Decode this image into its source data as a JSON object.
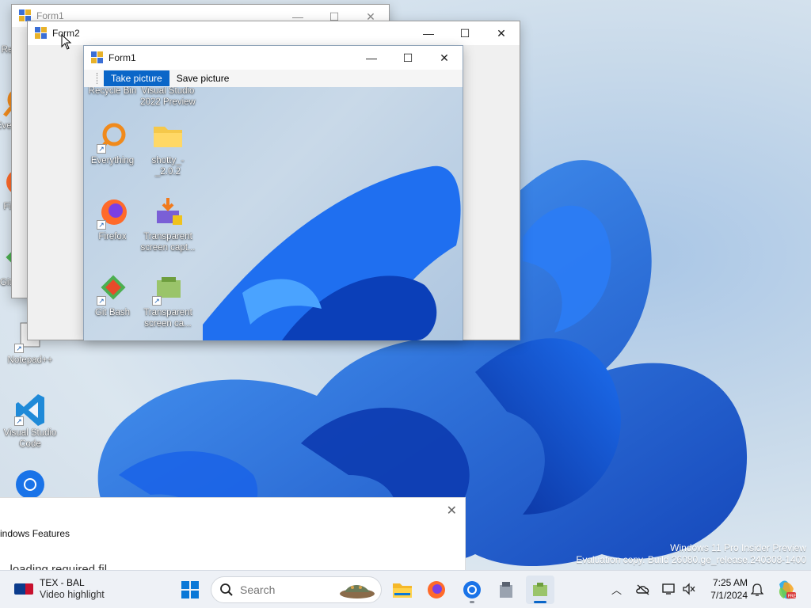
{
  "desktop": {
    "icons_outer": [
      {
        "label": "Recycle Bin"
      },
      {
        "label": "Everything"
      },
      {
        "label": "Firefox"
      },
      {
        "label": "Git Bash"
      },
      {
        "label": "Notepad++"
      },
      {
        "label": "Visual Studio Code"
      }
    ]
  },
  "form1_back": {
    "title": "Form1"
  },
  "form2": {
    "title": "Form2"
  },
  "form1": {
    "title": "Form1",
    "menu": {
      "take_label": "Take picture",
      "save_label": "Save picture"
    },
    "icons": [
      {
        "label": "Recycle Bin"
      },
      {
        "label": "Visual Studio 2022 Preview"
      },
      {
        "label": "Everything"
      },
      {
        "label": "shotty_-_2.0.2"
      },
      {
        "label": "Firefox"
      },
      {
        "label": "Transparent screen capt..."
      },
      {
        "label": "Git Bash"
      },
      {
        "label": "Transparent screen ca..."
      }
    ]
  },
  "notification": {
    "feature_text": "indows Features",
    "sub_text": "...loading required fil..."
  },
  "watermark": {
    "line1": "Windows 11 Pro Insider Preview",
    "line2": "Evaluation copy. Build 26080.ge_release.240308-1400"
  },
  "taskbar": {
    "widget_title": "TEX - BAL",
    "widget_sub": "Video highlight",
    "search_placeholder": "Search",
    "time": "7:25 AM",
    "date": "7/1/2024"
  }
}
